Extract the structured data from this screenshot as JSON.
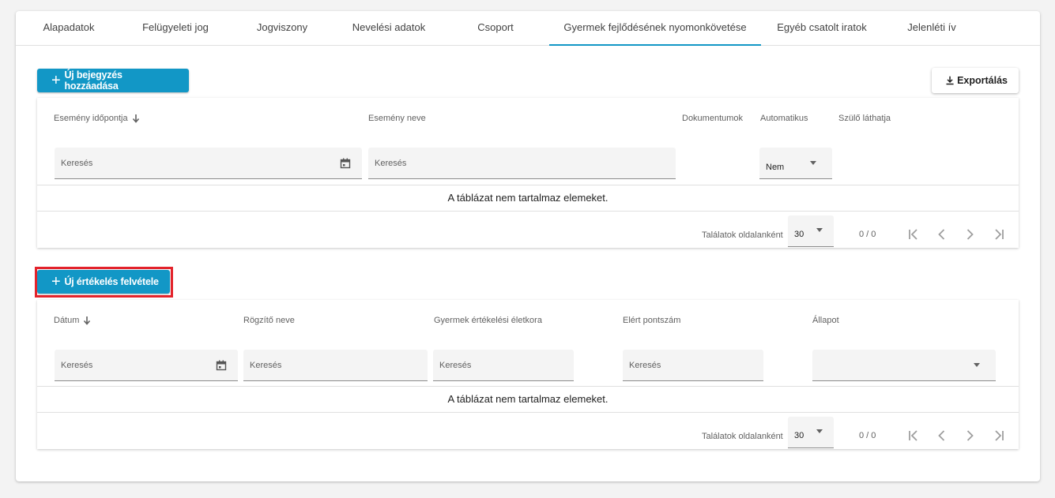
{
  "tabs": [
    {
      "label": "Alapadatok"
    },
    {
      "label": "Felügyeleti jog"
    },
    {
      "label": "Jogviszony"
    },
    {
      "label": "Nevelési adatok"
    },
    {
      "label": "Csoport"
    },
    {
      "label": "Gyermek fejlődésének nyomonkövetése"
    },
    {
      "label": "Egyéb csatolt iratok"
    },
    {
      "label": "Jelenléti ív"
    }
  ],
  "active_tab": "Gyermek fejlődésének nyomonkövetése",
  "events_section": {
    "add_button": "Új bejegyzés hozzáadása",
    "export_button": "Exportálás",
    "columns": {
      "time": "Esemény időpontja",
      "name": "Esemény neve",
      "documents": "Dokumentumok",
      "automatic": "Automatikus",
      "parent_visible": "Szülő láthatja"
    },
    "filters": {
      "time_placeholder": "Keresés",
      "name_placeholder": "Keresés",
      "automatic_value": "Nem"
    },
    "empty_text": "A táblázat nem tartalmaz elemeket.",
    "pagination": {
      "per_page_label": "Találatok oldalanként",
      "per_page_value": "30",
      "range": "0 / 0"
    }
  },
  "evaluations_section": {
    "add_button": "Új értékelés felvétele",
    "columns": {
      "date": "Dátum",
      "recorder": "Rögzítő neve",
      "age": "Gyermek értékelési életkora",
      "score": "Elért pontszám",
      "status": "Állapot"
    },
    "filters": {
      "date_placeholder": "Keresés",
      "recorder_placeholder": "Keresés",
      "age_placeholder": "Keresés",
      "score_placeholder": "Keresés",
      "status_value": ""
    },
    "empty_text": "A táblázat nem tartalmaz elemeket.",
    "pagination": {
      "per_page_label": "Találatok oldalanként",
      "per_page_value": "30",
      "range": "0 / 0"
    }
  },
  "colors": {
    "accent": "#1297c6",
    "highlight": "#e3232b"
  },
  "icons": [
    "plus-icon",
    "download-icon",
    "calendar-icon",
    "sort-arrow-down-icon",
    "dropdown-caret-icon",
    "first-page-icon",
    "previous-page-icon",
    "next-page-icon",
    "last-page-icon"
  ]
}
